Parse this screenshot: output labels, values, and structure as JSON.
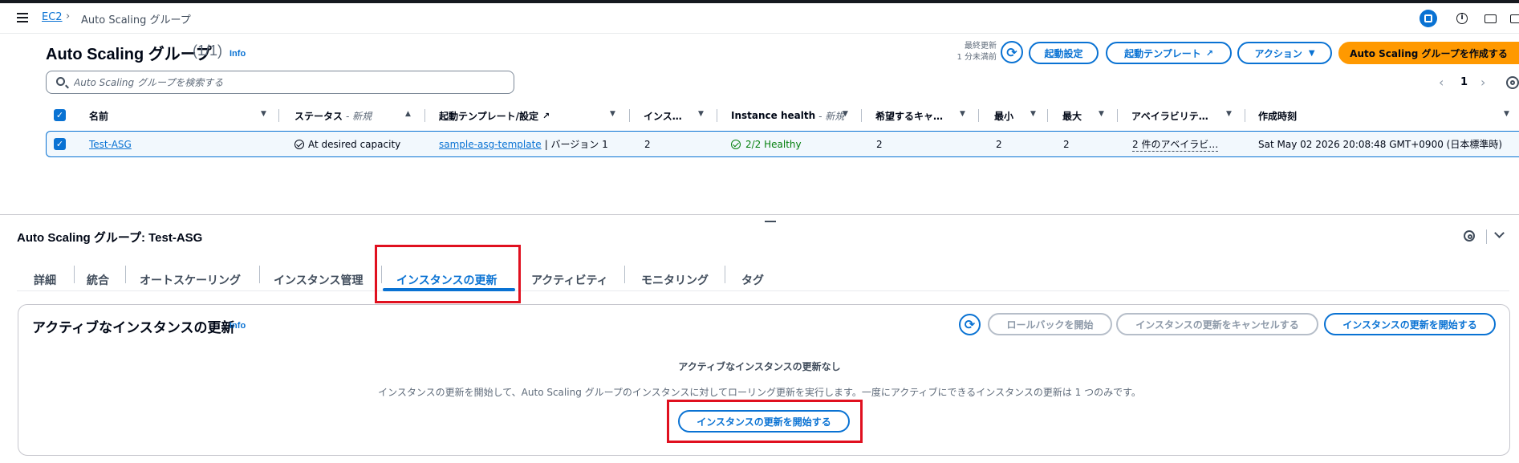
{
  "breadcrumb": {
    "root": "EC2",
    "current": "Auto Scaling グループ"
  },
  "list_panel": {
    "title": "Auto Scaling グループ",
    "count": "(1/1)",
    "info": "Info",
    "last_updated_label": "最終更新",
    "last_updated_value": "1 分未満前",
    "buttons": {
      "launch_config": "起動設定",
      "launch_template": "起動テンプレート",
      "actions": "アクション",
      "create": "Auto Scaling グループを作成する"
    },
    "search_placeholder": "Auto Scaling グループを検索する",
    "page": "1"
  },
  "table": {
    "columns": {
      "name": "名前",
      "status": "ステータス",
      "status_tag": "- 新規",
      "template": "起動テンプレート/設定",
      "instances": "インス…",
      "health": "Instance health",
      "health_tag": "- 新規",
      "desired": "希望するキャ…",
      "min": "最小",
      "max": "最大",
      "az": "アベイラビリテ…",
      "created": "作成時刻"
    },
    "rows": [
      {
        "name": "Test-ASG",
        "status": "At desired capacity",
        "template_link": "sample-asg-template",
        "template_version": "| バージョン 1",
        "instances": "2",
        "health": "2/2 Healthy",
        "desired": "2",
        "min": "2",
        "max": "2",
        "az": "2 件のアベイラビ…",
        "created": "Sat May 02 2026 20:08:48 GMT+0900 (日本標準時)"
      }
    ]
  },
  "detail": {
    "title": "Auto Scaling グループ: Test-ASG",
    "tabs": [
      "詳細",
      "統合",
      "オートスケーリング",
      "インスタンス管理",
      "インスタンスの更新",
      "アクティビティ",
      "モニタリング",
      "タグ"
    ],
    "active_tab": "インスタンスの更新",
    "section": {
      "title": "アクティブなインスタンスの更新",
      "info": "Info",
      "buttons": {
        "rollback": "ロールバックを開始",
        "cancel": "インスタンスの更新をキャンセルする",
        "start": "インスタンスの更新を開始する"
      },
      "empty_title": "アクティブなインスタンスの更新なし",
      "empty_desc": "インスタンスの更新を開始して、Auto Scaling グループのインスタンスに対してローリング更新を実行します。一度にアクティブにできるインスタンスの更新は 1 つのみです。",
      "empty_button": "インスタンスの更新を開始する"
    }
  },
  "colors": {
    "accent": "#0972d3",
    "primary_button": "#ff9900",
    "healthy": "#037f0c",
    "highlight_box": "#e0101f"
  },
  "icons": [
    "menu-icon",
    "chevron-right-icon",
    "panel-layout-icon",
    "info-icon",
    "video-icon",
    "refresh-icon",
    "external-link-icon",
    "caret-down-icon",
    "search-icon",
    "gear-icon",
    "checkbox-icon",
    "status-ok-icon",
    "healthy-icon",
    "chevron-down-icon"
  ]
}
